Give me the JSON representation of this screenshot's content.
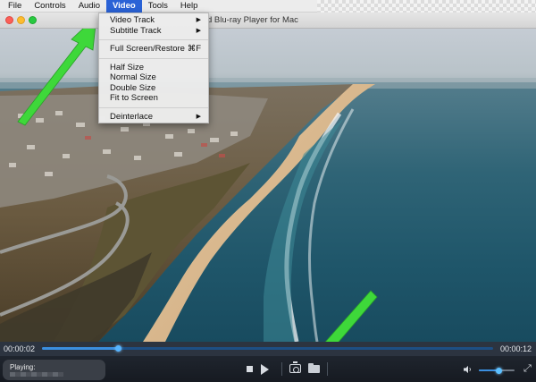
{
  "menubar": {
    "items": [
      {
        "label": "File",
        "active": false
      },
      {
        "label": "Controls",
        "active": false
      },
      {
        "label": "Audio",
        "active": false
      },
      {
        "label": "Video",
        "active": true
      },
      {
        "label": "Tools",
        "active": false
      },
      {
        "label": "Help",
        "active": false
      }
    ]
  },
  "window": {
    "title": "d Blu-ray Player for Mac"
  },
  "video_menu": {
    "items": [
      {
        "label": "Video Track",
        "submenu": true
      },
      {
        "label": "Subtitle Track",
        "submenu": true
      },
      {
        "label": "Full Screen/Restore",
        "shortcut": "⌘F"
      },
      {
        "label": "Half Size"
      },
      {
        "label": "Normal Size"
      },
      {
        "label": "Double Size"
      },
      {
        "label": "Fit to Screen"
      },
      {
        "label": "Deinterlace",
        "submenu": true
      }
    ]
  },
  "playback": {
    "current_time": "00:00:02",
    "total_time": "00:00:12",
    "progress": 0.17
  },
  "controls": {
    "playing_label": "Playing:",
    "volume": 0.55,
    "icons": {
      "stop": "stop-icon",
      "play": "play-icon",
      "snapshot": "camera-icon",
      "open": "folder-icon",
      "volume": "speaker-icon",
      "fullscreen": "fullscreen-icon"
    }
  },
  "colors": {
    "menu_highlight": "#2a62d6",
    "progress_fill": "#3b8fe0",
    "annotation_arrow": "#3ed83a"
  }
}
